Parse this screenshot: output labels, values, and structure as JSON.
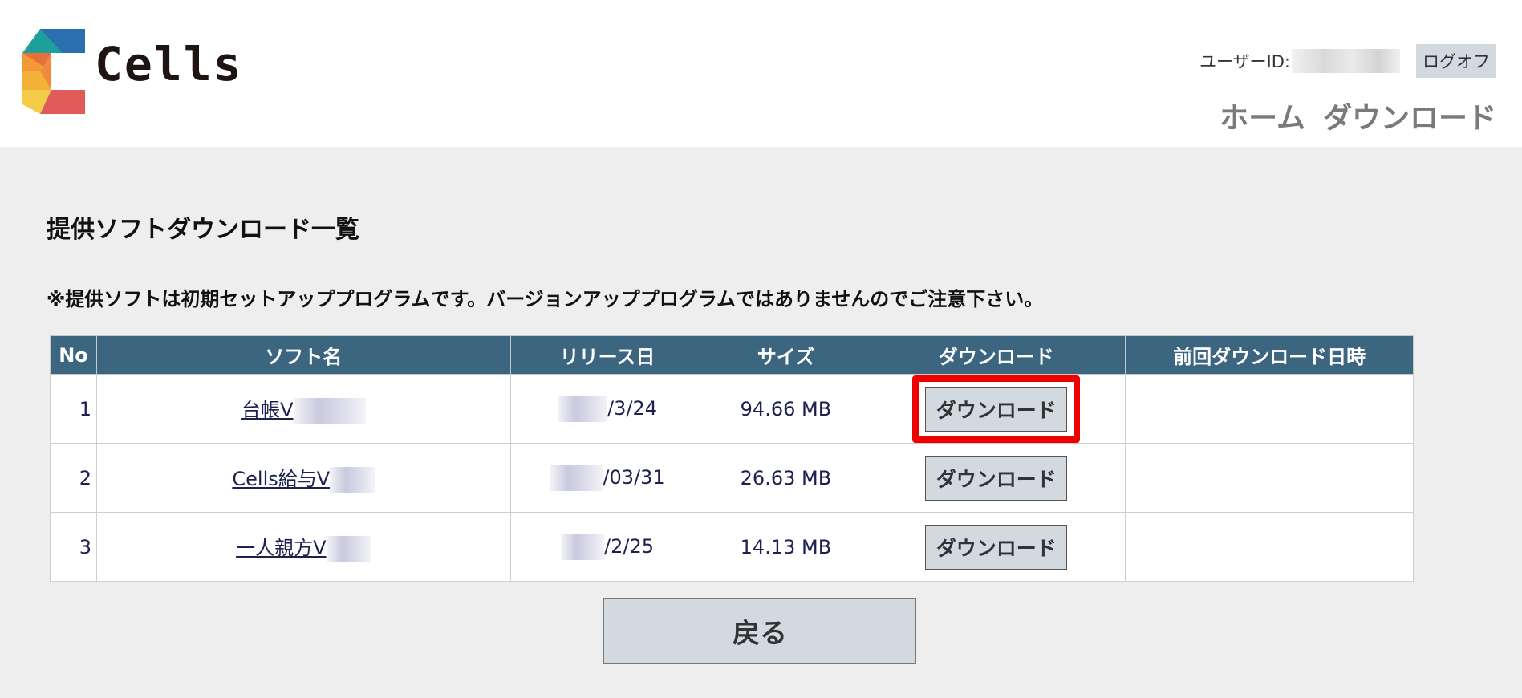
{
  "header": {
    "logo_text": "Cells",
    "user_label": "ユーザーID:",
    "logoff_label": "ログオフ",
    "nav": [
      {
        "label": "ホーム"
      },
      {
        "label": "ダウンロード"
      }
    ]
  },
  "main": {
    "title": "提供ソフトダウンロード一覧",
    "notice": "※提供ソフトは初期セットアッププログラムです。バージョンアッププログラムではありませんのでご注意下さい。",
    "table": {
      "headers": [
        "No",
        "ソフト名",
        "リリース日",
        "サイズ",
        "ダウンロード",
        "前回ダウンロード日時"
      ],
      "rows": [
        {
          "no": "1",
          "name": "台帳V",
          "release": "/3/24",
          "size": "94.66 MB",
          "download": "ダウンロード",
          "last": ""
        },
        {
          "no": "2",
          "name": "Cells給与V",
          "release": "/03/31",
          "size": "26.63 MB",
          "download": "ダウンロード",
          "last": ""
        },
        {
          "no": "3",
          "name": "一人親方V",
          "release": "/2/25",
          "size": "14.13 MB",
          "download": "ダウンロード",
          "last": ""
        }
      ]
    },
    "back_label": "戻る"
  },
  "colors": {
    "header_row": "#3c6680",
    "highlight": "#ee0000",
    "button": "#d3dadf"
  }
}
